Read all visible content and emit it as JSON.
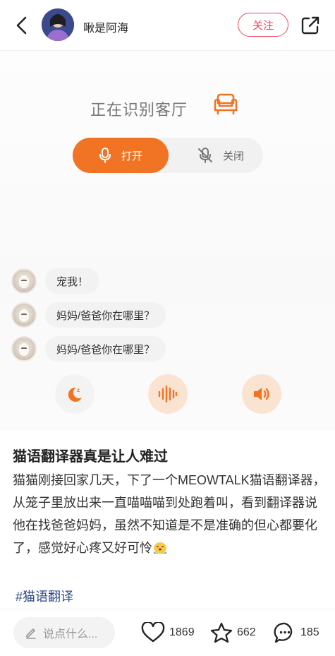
{
  "header": {
    "author_name": "啾是阿海",
    "follow_label": "关注"
  },
  "photo": {
    "recognizing_text": "正在识别客厅",
    "toggle": {
      "on_label": "打开",
      "off_label": "关闭"
    },
    "messages": [
      {
        "text": "宠我！"
      },
      {
        "text": "妈妈/爸爸你在哪里？"
      },
      {
        "text": "妈妈/爸爸你在哪里？"
      }
    ],
    "colors": {
      "accent": "#f07424",
      "accent_light": "#fbe3d2"
    }
  },
  "post": {
    "title": "猫语翻译器真是让人难过",
    "body": "猫猫刚接回家几天，下了一个MEOWTALK猫语翻译器，从笼子里放出来一直喵喵喵到处跑着叫，看到翻译器说他在找爸爸妈妈，虽然不知道是不是准确的但心都要化了，感觉好心疼又好可怜",
    "tag": "#猫语翻译"
  },
  "bottom": {
    "comment_placeholder": "说点什么...",
    "likes": "1869",
    "stars": "662",
    "comments": "185"
  }
}
